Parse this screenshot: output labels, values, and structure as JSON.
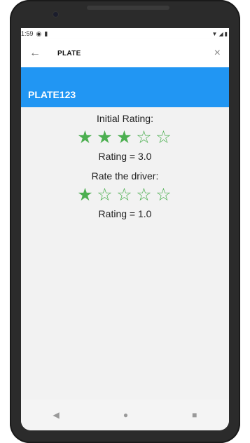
{
  "status": {
    "time": "1:59"
  },
  "app_bar": {
    "title": "PLATE",
    "back_icon": "←",
    "close_icon": "×"
  },
  "plate": {
    "number": "PLATE123",
    "color": "#2196f3"
  },
  "initial_rating": {
    "label": "Initial Rating:",
    "stars": [
      1,
      1,
      1,
      0,
      0
    ],
    "text": "Rating = 3.0",
    "value": 3.0
  },
  "driver_rating": {
    "label": "Rate the driver:",
    "stars": [
      1,
      0,
      0,
      0,
      0
    ],
    "text": "Rating = 1.0",
    "value": 1.0
  },
  "accent_star_color": "#4caf50",
  "nav": {
    "back_icon": "◀",
    "home_icon": "●",
    "recents_icon": "■"
  }
}
